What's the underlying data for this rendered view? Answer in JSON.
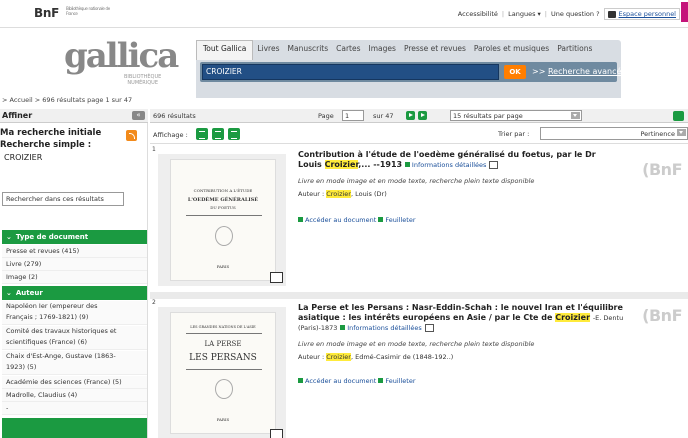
{
  "topbar": {
    "bnf_logo": "BnF",
    "bnf_subtitle": "Bibliothèque nationale de France",
    "links": [
      "Accessibilité",
      "Langues ▾",
      "Une question ?"
    ],
    "espace": "Espace personnel"
  },
  "header": {
    "gallica_logo": "gallica",
    "gallica_subtitle": "BIBLIOTHÈQUE NUMÉRIQUE",
    "tabs": [
      "Tout Gallica",
      "Livres",
      "Manuscrits",
      "Cartes",
      "Images",
      "Presse et revues",
      "Paroles et musiques",
      "Partitions"
    ],
    "search_value": "CROIZIER",
    "ok_label": "OK",
    "advanced_label": "Recherche avancée",
    "advanced_prefix": ">>"
  },
  "breadcrumb": "> Accueil  > 696 résultats page 1 sur 47",
  "sidebar": {
    "title": "Affiner",
    "collapse": "«",
    "ma_recherche": "Ma recherche initiale",
    "recherche_simple": "Recherche simple :",
    "query": "CROIZIER",
    "refine_placeholder": "Rechercher dans ces résultats",
    "facet_type": "Type de document",
    "type_items": [
      "Presse et revues (415)",
      "Livre (279)",
      "Image (2)"
    ],
    "facet_author": "Auteur",
    "author_items": [
      "Napoléon Ier (empereur des",
      "Français ; 1769-1821) (9)",
      "Comité des travaux historiques et",
      "scientifiques (France) (6)",
      "Chaix d'Est-Ange, Gustave (1863-",
      "1923) (5)",
      "Académie des sciences (France) (5)",
      "Madrolle, Claudius (4)",
      "-"
    ]
  },
  "results_bar": {
    "count": "696 résultats",
    "page_label": "Page",
    "page_value": "1",
    "page_total": "sur 47",
    "per_page": "15 résultats par page"
  },
  "display_bar": {
    "affichage": "Affichage :",
    "trier": "Trier par :",
    "sort_value": "Pertinence"
  },
  "results": [
    {
      "num": "1",
      "title_a": "Contribution à l'étude de l'oedème généralisé du foetus, par le Dr Louis",
      "title_hl": "Croizier",
      "title_b": ",... --1913",
      "info": "Informations détaillées",
      "mode": "Livre en mode image et en mode texte, recherche plein texte disponible",
      "author_label": "Auteur : ",
      "author_hl": "Croizier",
      "author_rest": ", Louis (Dr)",
      "access": "Accéder au document",
      "feuilleter": "Feuilleter",
      "bnf_mark": "(BnF",
      "thumb": {
        "top": "CONTRIBUTION A L'ÉTUDE",
        "mid": "L'OEDÈME GÉNÉRALISÉ",
        "sub": "DU FOETUS",
        "foot": "PARIS"
      }
    },
    {
      "num": "2",
      "title_a": "La Perse et les Persans : Nasr-Eddin-Schah : le nouvel Iran et l'équilibre asiatique : les intérêts européens en Asie / par le Cte de",
      "title_hl": "Croizier",
      "title_b": "-E. Dentu (Paris)-1873",
      "info": "Informations détaillées",
      "mode": "Livre en mode image et en mode texte, recherche plein texte disponible",
      "author_label": "Auteur : ",
      "author_hl": "Croizier",
      "author_rest": ", Edmé-Casimir de (1848-192..)",
      "access": "Accéder au document",
      "feuilleter": "Feuilleter",
      "bnf_mark": "(BnF",
      "thumb": {
        "top": "LES GRANDES NATIONS DE L'ASIE",
        "mid": "LA PERSE",
        "sub": "LES PERSANS",
        "foot": "PARIS"
      }
    }
  ]
}
